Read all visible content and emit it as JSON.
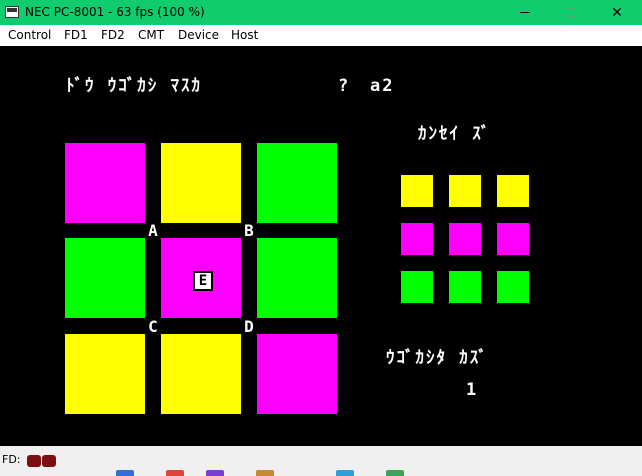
{
  "window": {
    "title": "NEC PC-8001 - 63 fps (100 %)",
    "titlebar_color": "#10cc6c",
    "close_glyph": "✕"
  },
  "menu": {
    "items": [
      "Control",
      "FD1",
      "FD2",
      "CMT",
      "Device",
      "Host"
    ]
  },
  "screen": {
    "prompt_text": "ﾄﾞｳ ｳｺﾞｶｼ ﾏｽｶ",
    "prompt_question": "?",
    "prompt_answer": "a2",
    "goal_title": "ｶﾝｾｲ ｽﾞ",
    "moves_label": "ｳｺﾞｶｼﾀ ｶｽﾞ",
    "moves_count": "1",
    "corner_labels": [
      "A",
      "B",
      "C",
      "D"
    ],
    "cursor_label": "E",
    "colors": {
      "magenta": "#ff00ff",
      "yellow": "#ffff00",
      "green": "#00ff00",
      "background": "#000000"
    },
    "board": [
      [
        "magenta",
        "yellow",
        "green"
      ],
      [
        "green",
        "magenta",
        "green"
      ],
      [
        "yellow",
        "yellow",
        "magenta"
      ]
    ],
    "goal": [
      [
        "yellow",
        "yellow",
        "yellow"
      ],
      [
        "magenta",
        "magenta",
        "magenta"
      ],
      [
        "green",
        "green",
        "green"
      ]
    ]
  },
  "status": {
    "label": "FD:",
    "led_color": "#7a1010"
  }
}
